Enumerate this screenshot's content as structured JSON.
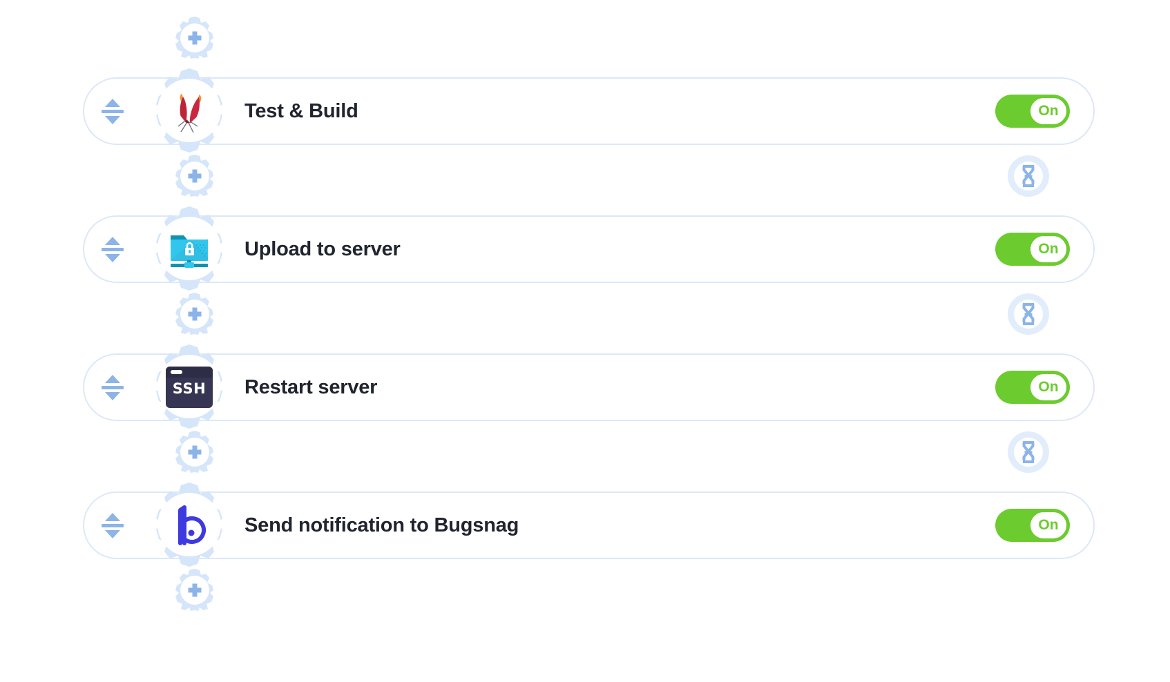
{
  "theme": {
    "accent_blue": "#8cb4e8",
    "gear_fill": "#d5e5fa",
    "row_border": "#dce8f8",
    "toggle_on": "#6ccb2e",
    "text_color": "#20242e"
  },
  "pipeline": {
    "steps": [
      {
        "label": "Test & Build",
        "icon": "apache-feather-icon",
        "toggle_label": "On",
        "toggle_state": "on",
        "drag_handle": "drag-handle"
      },
      {
        "label": "Upload to server",
        "icon": "sftp-folder-lock-icon",
        "toggle_label": "On",
        "toggle_state": "on",
        "drag_handle": "drag-handle"
      },
      {
        "label": "Restart server",
        "icon": "ssh-terminal-icon",
        "icon_text": "SSH",
        "toggle_label": "On",
        "toggle_state": "on",
        "drag_handle": "drag-handle"
      },
      {
        "label": "Send notification to Bugsnag",
        "icon": "bugsnag-logo-icon",
        "toggle_label": "On",
        "toggle_state": "on",
        "drag_handle": "drag-handle"
      }
    ],
    "add_buttons": [
      {
        "icon": "plus-gear-icon"
      },
      {
        "icon": "plus-gear-icon"
      },
      {
        "icon": "plus-gear-icon"
      },
      {
        "icon": "plus-gear-icon"
      },
      {
        "icon": "plus-gear-icon"
      }
    ],
    "delay_buttons": [
      {
        "icon": "hourglass-icon"
      },
      {
        "icon": "hourglass-icon"
      },
      {
        "icon": "hourglass-icon"
      }
    ]
  }
}
